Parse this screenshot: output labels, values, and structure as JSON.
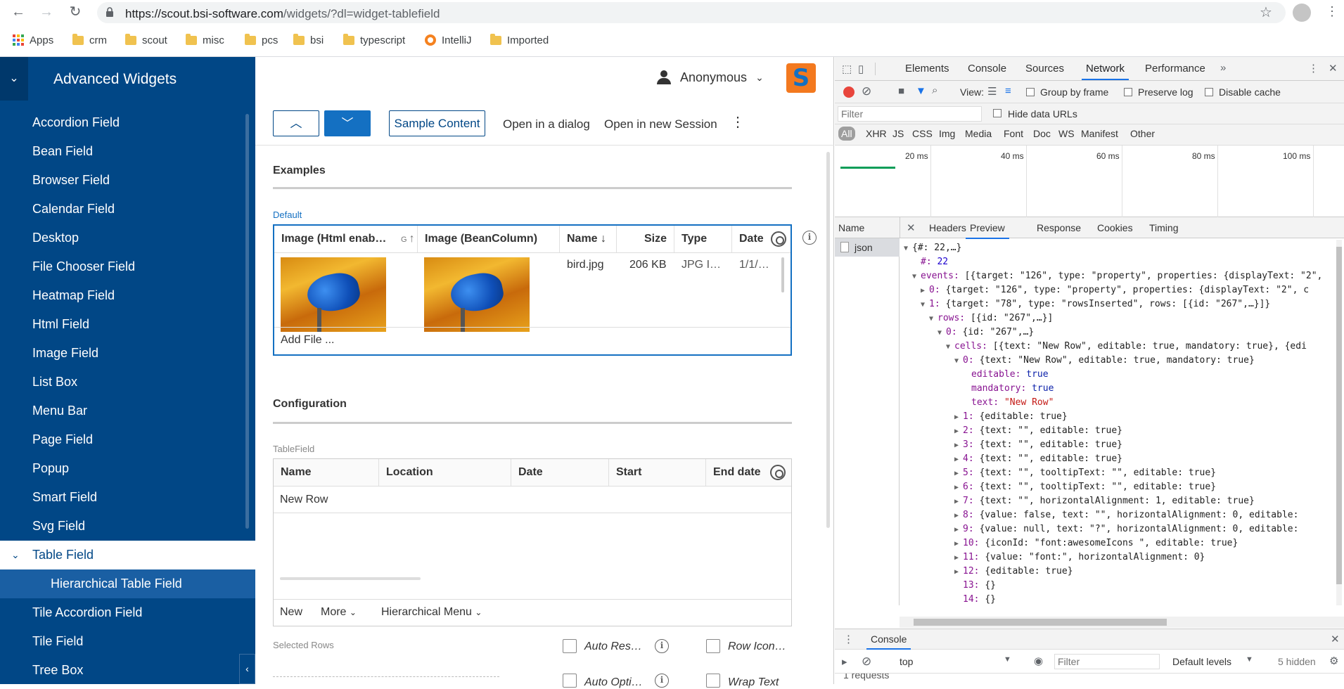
{
  "browser": {
    "url_host": "https://scout.bsi-software.com",
    "url_path": "/widgets/?dl=widget-tablefield",
    "bookmarks": [
      "Apps",
      "crm",
      "scout",
      "misc",
      "pcs",
      "bsi",
      "typescript",
      "IntelliJ",
      "Imported"
    ]
  },
  "nav": {
    "title": "Advanced Widgets",
    "items": [
      {
        "label": "Accordion Field"
      },
      {
        "label": "Bean Field"
      },
      {
        "label": "Browser Field"
      },
      {
        "label": "Calendar Field"
      },
      {
        "label": "Desktop"
      },
      {
        "label": "File Chooser Field"
      },
      {
        "label": "Heatmap Field"
      },
      {
        "label": "Html Field"
      },
      {
        "label": "Image Field"
      },
      {
        "label": "List Box"
      },
      {
        "label": "Menu Bar"
      },
      {
        "label": "Page Field"
      },
      {
        "label": "Popup"
      },
      {
        "label": "Smart Field"
      },
      {
        "label": "Svg Field"
      },
      {
        "label": "Table Field"
      },
      {
        "label": "Hierarchical Table Field"
      },
      {
        "label": "Tile Accordion Field"
      },
      {
        "label": "Tile Field"
      },
      {
        "label": "Tree Box"
      }
    ]
  },
  "header": {
    "user": "Anonymous"
  },
  "toolbar": {
    "sample_content": "Sample Content",
    "open_dialog": "Open in a dialog",
    "open_session": "Open in new Session"
  },
  "examples": {
    "title": "Examples",
    "label": "Default",
    "columns": [
      "Image (Html enab…",
      "G",
      "Image (BeanColumn)",
      "Name",
      "Size",
      "Type",
      "Date"
    ],
    "row": {
      "name": "bird.jpg",
      "size": "206 KB",
      "type": "JPG I…",
      "date": "1/1/…"
    },
    "add_file": "Add File ..."
  },
  "configuration": {
    "title": "Configuration",
    "label": "TableField",
    "columns": [
      "Name",
      "Location",
      "Date",
      "Start",
      "End date"
    ],
    "row": "New Row",
    "footer": {
      "new": "New",
      "more": "More",
      "hier_menu": "Hierarchical Menu"
    },
    "selected_rows": "Selected Rows",
    "auto_res": "Auto Res…",
    "row_icon": "Row Icon…",
    "auto_opti": "Auto Opti…",
    "wrap_text": "Wrap Text"
  },
  "devtools": {
    "tabs": [
      "Elements",
      "Console",
      "Sources",
      "Network",
      "Performance"
    ],
    "view_label": "View:",
    "group_by_frame": "Group by frame",
    "preserve_log": "Preserve log",
    "disable_cache": "Disable cache",
    "filter_placeholder": "Filter",
    "hide_data_urls": "Hide data URLs",
    "types": [
      "All",
      "XHR",
      "JS",
      "CSS",
      "Img",
      "Media",
      "Font",
      "Doc",
      "WS",
      "Manifest",
      "Other"
    ],
    "timeline_labels": [
      "20 ms",
      "40 ms",
      "60 ms",
      "80 ms",
      "100 ms"
    ],
    "req_head_name": "Name",
    "detail_tabs": [
      "Headers",
      "Preview",
      "Response",
      "Cookies",
      "Timing"
    ],
    "request": "json",
    "requests_count": "1 requests",
    "preview_lines": [
      {
        "i": 0,
        "t": "▼",
        "s": "{#: 22,…}"
      },
      {
        "i": 1,
        "t": "",
        "k": "#",
        "v": "22",
        "vc": "num"
      },
      {
        "i": 1,
        "t": "▼",
        "k": "events",
        "s": "[{target: \"126\", type: \"property\", properties: {displayText: \"2\","
      },
      {
        "i": 2,
        "t": "▶",
        "k": "0",
        "s": "{target: \"126\", type: \"property\", properties: {displayText: \"2\", c"
      },
      {
        "i": 2,
        "t": "▼",
        "k": "1",
        "s": "{target: \"78\", type: \"rowsInserted\", rows: [{id: \"267\",…}]}"
      },
      {
        "i": 3,
        "t": "▼",
        "k": "rows",
        "s": "[{id: \"267\",…}]"
      },
      {
        "i": 4,
        "t": "▼",
        "k": "0",
        "s": "{id: \"267\",…}"
      },
      {
        "i": 5,
        "t": "▼",
        "k": "cells",
        "s": "[{text: \"New Row\", editable: true, mandatory: true}, {edi"
      },
      {
        "i": 6,
        "t": "▼",
        "k": "0",
        "s": "{text: \"New Row\", editable: true, mandatory: true}"
      },
      {
        "i": 7,
        "t": "",
        "k": "editable",
        "v": "true",
        "vc": "bool"
      },
      {
        "i": 7,
        "t": "",
        "k": "mandatory",
        "v": "true",
        "vc": "bool"
      },
      {
        "i": 7,
        "t": "",
        "k": "text",
        "v": "\"New Row\"",
        "vc": "str"
      },
      {
        "i": 6,
        "t": "▶",
        "k": "1",
        "s": "{editable: true}"
      },
      {
        "i": 6,
        "t": "▶",
        "k": "2",
        "s": "{text: \"\", editable: true}"
      },
      {
        "i": 6,
        "t": "▶",
        "k": "3",
        "s": "{text: \"\", editable: true}"
      },
      {
        "i": 6,
        "t": "▶",
        "k": "4",
        "s": "{text: \"\", editable: true}"
      },
      {
        "i": 6,
        "t": "▶",
        "k": "5",
        "s": "{text: \"\", tooltipText: \"\", editable: true}"
      },
      {
        "i": 6,
        "t": "▶",
        "k": "6",
        "s": "{text: \"\", tooltipText: \"\", editable: true}"
      },
      {
        "i": 6,
        "t": "▶",
        "k": "7",
        "s": "{text: \"\", horizontalAlignment: 1, editable: true}"
      },
      {
        "i": 6,
        "t": "▶",
        "k": "8",
        "s": "{value: false, text: \"\", horizontalAlignment: 0, editable:"
      },
      {
        "i": 6,
        "t": "▶",
        "k": "9",
        "s": "{value: null, text: \"?\", horizontalAlignment: 0, editable:"
      },
      {
        "i": 6,
        "t": "▶",
        "k": "10",
        "s": "{iconId: \"font:awesomeIcons \", editable: true}"
      },
      {
        "i": 6,
        "t": "▶",
        "k": "11",
        "s": "{value: \"font:\", horizontalAlignment: 0}"
      },
      {
        "i": 6,
        "t": "▶",
        "k": "12",
        "s": "{editable: true}"
      },
      {
        "i": 6,
        "t": "",
        "k": "13",
        "s": "{}"
      },
      {
        "i": 6,
        "t": "",
        "k": "14",
        "s": "{}"
      }
    ],
    "console_tab": "Console",
    "console_context": "top",
    "console_filter": "Filter",
    "default_levels": "Default levels",
    "hidden": "5 hidden"
  }
}
